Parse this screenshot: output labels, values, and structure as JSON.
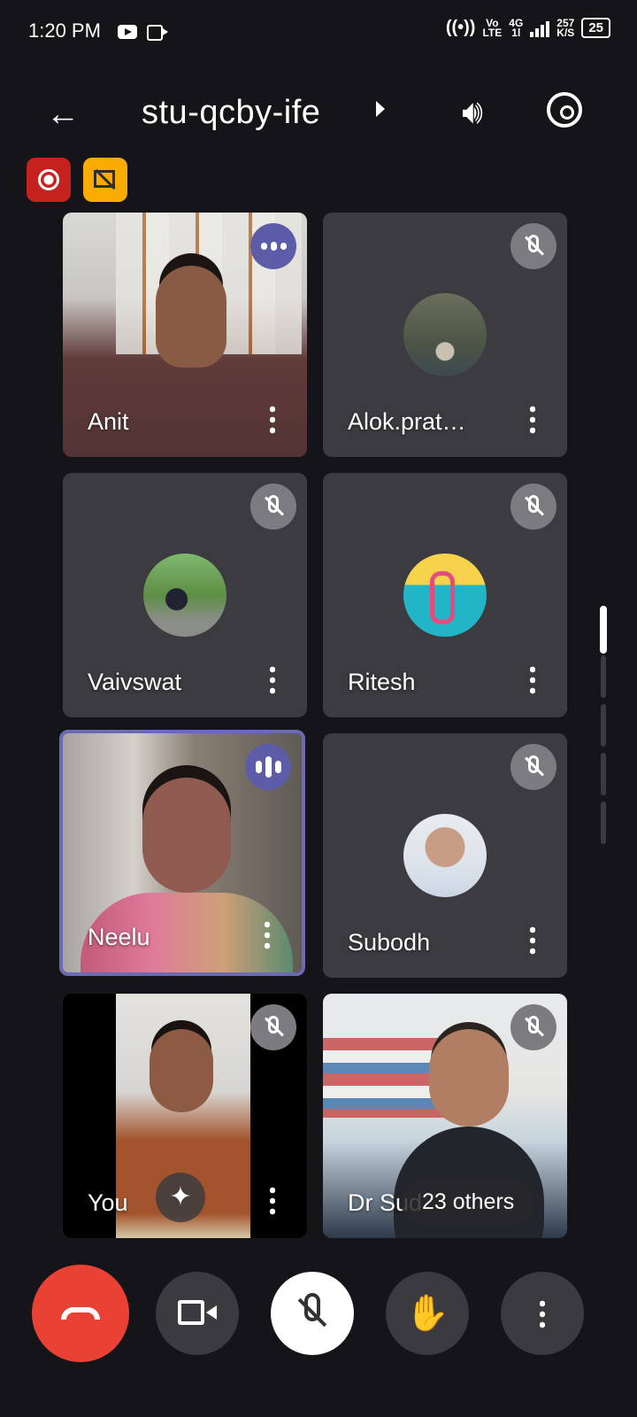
{
  "status_bar": {
    "time": "1:20 PM",
    "vo_line1": "Vo",
    "vo_line2": "LTE",
    "net_line1": "4G",
    "net_line2": "1l",
    "speed_value": "257",
    "speed_unit": "K/S",
    "battery": "25"
  },
  "meeting": {
    "title": "stu-qcby-ife"
  },
  "tiles": [
    {
      "name": "Anit",
      "state": "speaking"
    },
    {
      "name": "Alok.prat…",
      "state": "muted"
    },
    {
      "name": "Vaivswat",
      "state": "muted"
    },
    {
      "name": "Ritesh",
      "state": "muted"
    },
    {
      "name": "Neelu",
      "state": "speaking"
    },
    {
      "name": "Subodh",
      "state": "muted"
    },
    {
      "name": "You",
      "state": "muted"
    },
    {
      "name": "Dr Sud",
      "state": "muted"
    }
  ],
  "others_chip": "23 others",
  "colors": {
    "background": "#151519",
    "tile": "#3b3b40",
    "active_border": "#6b6ab5",
    "end_call": "#e94235",
    "record_badge": "#c5221f",
    "camera_badge": "#f9ab00"
  },
  "icons": {
    "back": "arrow-left",
    "speaker": "volume",
    "switch_camera": "camera-rotate",
    "raise_hand": "hand"
  }
}
